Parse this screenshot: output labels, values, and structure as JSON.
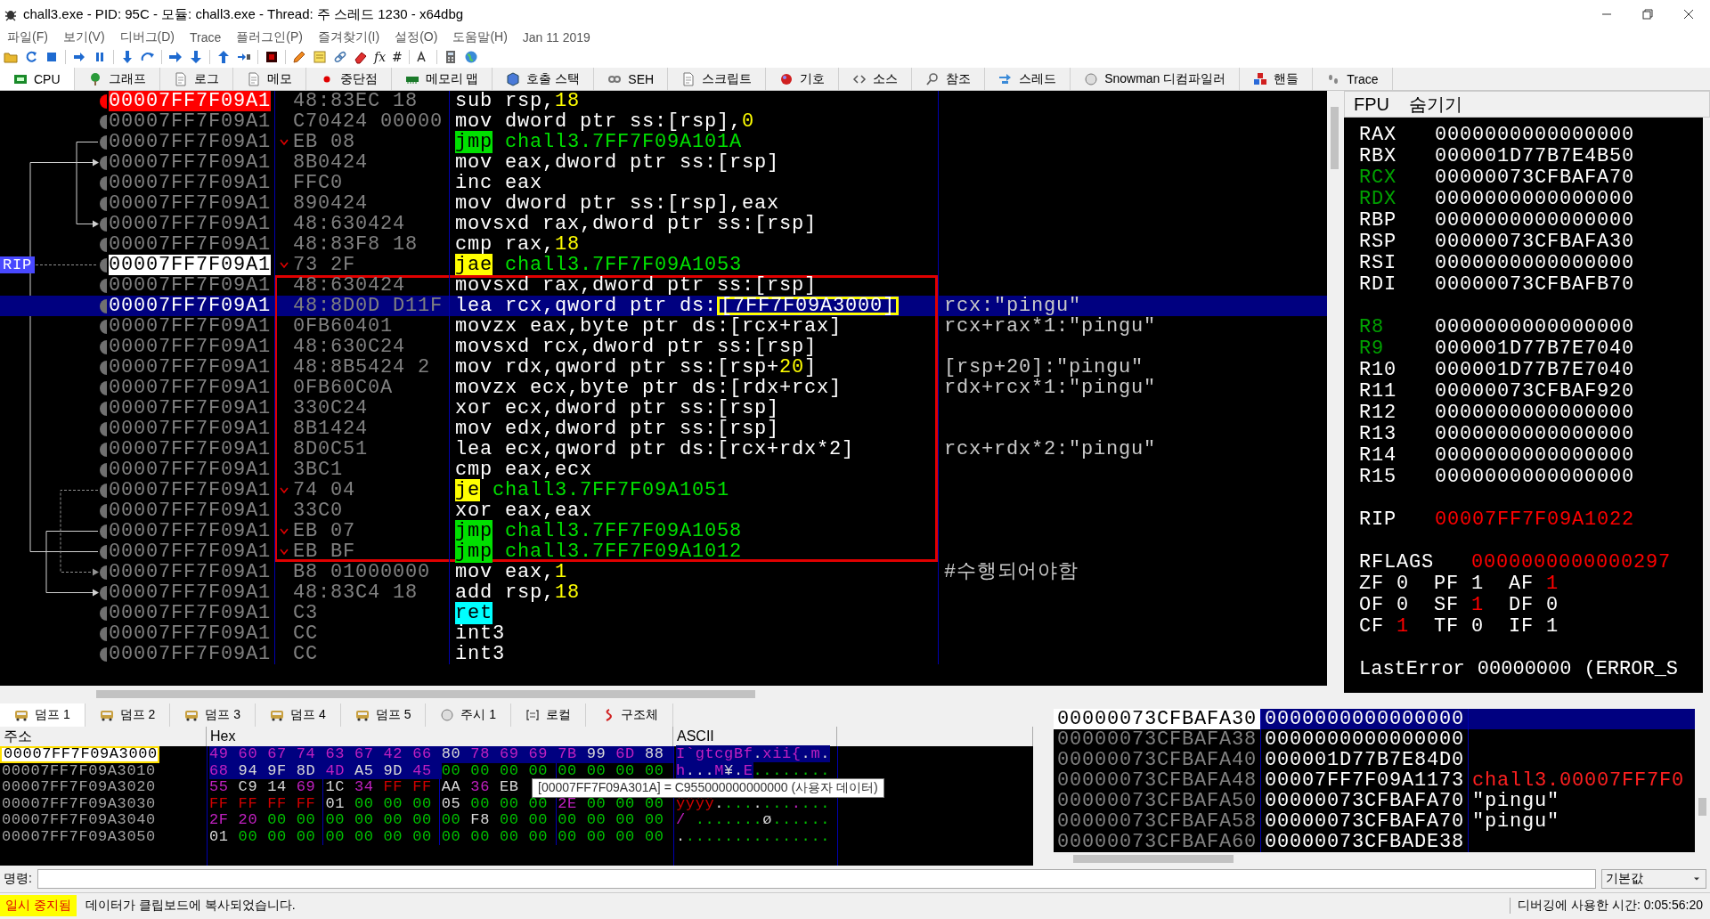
{
  "window": {
    "title": "chall3.exe - PID: 95C - 모듈: chall3.exe - Thread: 주 스레드 1230 - x64dbg"
  },
  "menu": [
    "파일(F)",
    "보기(V)",
    "디버그(D)",
    "Trace",
    "플러그인(P)",
    "즐겨찾기(I)",
    "설정(O)",
    "도움말(H)",
    "Jan 11 2019"
  ],
  "toolbar_texts": [
    "fx",
    "#"
  ],
  "tabs": [
    {
      "label": "CPU",
      "selected": true
    },
    {
      "label": "그래프",
      "selected": false
    },
    {
      "label": "로그",
      "selected": false
    },
    {
      "label": "메모",
      "selected": false
    },
    {
      "label": "중단점",
      "selected": false
    },
    {
      "label": "메모리 맵",
      "selected": false
    },
    {
      "label": "호출 스택",
      "selected": false
    },
    {
      "label": "SEH",
      "selected": false
    },
    {
      "label": "스크립트",
      "selected": false
    },
    {
      "label": "기호",
      "selected": false
    },
    {
      "label": "소스",
      "selected": false
    },
    {
      "label": "참조",
      "selected": false
    },
    {
      "label": "스레드",
      "selected": false
    },
    {
      "label": "Snowman 디컴파일러",
      "selected": false
    },
    {
      "label": "핸들",
      "selected": false
    },
    {
      "label": "Trace",
      "selected": false
    }
  ],
  "disasm": {
    "rip_label": "RIP",
    "rows": [
      {
        "address": "00007FF7F09A1",
        "bytes": "48:83EC 18",
        "mnemonic": "sub",
        "kind": "plain",
        "ops": [
          {
            "text": "rsp,",
            "kind": "text"
          },
          {
            "text": "18",
            "kind": "num"
          }
        ],
        "selected": false,
        "breakpoint": true,
        "current": false,
        "boxed": false
      },
      {
        "address": "00007FF7F09A1",
        "bytes": "C70424 00000",
        "mnemonic": "mov",
        "kind": "plain",
        "ops": [
          {
            "text": "dword ptr ss:[rsp],",
            "kind": "text"
          },
          {
            "text": "0",
            "kind": "num"
          }
        ],
        "selected": false,
        "breakpoint": false,
        "current": false,
        "boxed": false
      },
      {
        "address": "00007FF7F09A1",
        "bytes": "EB 08",
        "mnemonic": "jmp",
        "kind": "jump",
        "ops": [
          {
            "text": "chall3.7FF7F09A101A",
            "kind": "label"
          }
        ],
        "selected": false,
        "breakpoint": false,
        "current": false,
        "boxed": false
      },
      {
        "address": "00007FF7F09A1",
        "bytes": "8B0424",
        "mnemonic": "mov",
        "kind": "plain",
        "ops": [
          {
            "text": "eax,dword ptr ss:[rsp]",
            "kind": "text"
          }
        ],
        "selected": false,
        "breakpoint": false,
        "current": false,
        "boxed": false
      },
      {
        "address": "00007FF7F09A1",
        "bytes": "FFC0",
        "mnemonic": "inc",
        "kind": "plain",
        "ops": [
          {
            "text": "eax",
            "kind": "text"
          }
        ],
        "selected": false,
        "breakpoint": false,
        "current": false,
        "boxed": false
      },
      {
        "address": "00007FF7F09A1",
        "bytes": "890424",
        "mnemonic": "mov",
        "kind": "plain",
        "ops": [
          {
            "text": "dword ptr ss:[rsp],eax",
            "kind": "text"
          }
        ],
        "selected": false,
        "breakpoint": false,
        "current": false,
        "boxed": false
      },
      {
        "address": "00007FF7F09A1",
        "bytes": "48:630424",
        "mnemonic": "movsxd",
        "kind": "plain",
        "ops": [
          {
            "text": "rax,dword ptr ss:[rsp]",
            "kind": "text"
          }
        ],
        "selected": false,
        "breakpoint": false,
        "current": false,
        "boxed": false
      },
      {
        "address": "00007FF7F09A1",
        "bytes": "48:83F8 18",
        "mnemonic": "cmp",
        "kind": "plain",
        "ops": [
          {
            "text": "rax,",
            "kind": "text"
          },
          {
            "text": "18",
            "kind": "num"
          }
        ],
        "selected": false,
        "breakpoint": false,
        "current": false,
        "boxed": false
      },
      {
        "address": "00007FF7F09A1",
        "bytes": "73 2F",
        "mnemonic": "jae",
        "kind": "cond",
        "ops": [
          {
            "text": "chall3.7FF7F09A1053",
            "kind": "label"
          }
        ],
        "selected": false,
        "breakpoint": false,
        "current": true,
        "boxed": false
      },
      {
        "address": "00007FF7F09A1",
        "bytes": "48:630424",
        "mnemonic": "movsxd",
        "kind": "plain",
        "ops": [
          {
            "text": "rax,dword ptr ss:[rsp]",
            "kind": "text"
          }
        ],
        "selected": false,
        "breakpoint": false,
        "current": false,
        "boxed": true
      },
      {
        "address": "00007FF7F09A1",
        "bytes": "48:8D0D D11F",
        "mnemonic": "lea",
        "kind": "plain",
        "ops": [
          {
            "text": "rcx,qword ptr ds:",
            "kind": "text"
          },
          {
            "text": "[7FF7F09A3000]",
            "kind": "boxed"
          }
        ],
        "comment": "rcx:\"pingu\"",
        "selected": true,
        "breakpoint": false,
        "current": false,
        "boxed": true
      },
      {
        "address": "00007FF7F09A1",
        "bytes": "0FB60401",
        "mnemonic": "movzx",
        "kind": "plain",
        "ops": [
          {
            "text": "eax,byte ptr ds:[rcx+rax]",
            "kind": "text"
          }
        ],
        "comment": "rcx+rax*1:\"pingu\"",
        "selected": false,
        "breakpoint": false,
        "current": false,
        "boxed": true
      },
      {
        "address": "00007FF7F09A1",
        "bytes": "48:630C24",
        "mnemonic": "movsxd",
        "kind": "plain",
        "ops": [
          {
            "text": "rcx,dword ptr ss:[rsp]",
            "kind": "text"
          }
        ],
        "selected": false,
        "breakpoint": false,
        "current": false,
        "boxed": true
      },
      {
        "address": "00007FF7F09A1",
        "bytes": "48:8B5424 2",
        "mnemonic": "mov",
        "kind": "plain",
        "ops": [
          {
            "text": "rdx,qword ptr ss:[rsp+",
            "kind": "text"
          },
          {
            "text": "20",
            "kind": "num"
          },
          {
            "text": "]",
            "kind": "text"
          }
        ],
        "comment": "[rsp+20]:\"pingu\"",
        "selected": false,
        "breakpoint": false,
        "current": false,
        "boxed": true
      },
      {
        "address": "00007FF7F09A1",
        "bytes": "0FB60C0A",
        "mnemonic": "movzx",
        "kind": "plain",
        "ops": [
          {
            "text": "ecx,byte ptr ds:[rdx+rcx]",
            "kind": "text"
          }
        ],
        "comment": "rdx+rcx*1:\"pingu\"",
        "selected": false,
        "breakpoint": false,
        "current": false,
        "boxed": true
      },
      {
        "address": "00007FF7F09A1",
        "bytes": "330C24",
        "mnemonic": "xor",
        "kind": "plain",
        "ops": [
          {
            "text": "ecx,dword ptr ss:[rsp]",
            "kind": "text"
          }
        ],
        "selected": false,
        "breakpoint": false,
        "current": false,
        "boxed": true
      },
      {
        "address": "00007FF7F09A1",
        "bytes": "8B1424",
        "mnemonic": "mov",
        "kind": "plain",
        "ops": [
          {
            "text": "edx,dword ptr ss:[rsp]",
            "kind": "text"
          }
        ],
        "selected": false,
        "breakpoint": false,
        "current": false,
        "boxed": true
      },
      {
        "address": "00007FF7F09A1",
        "bytes": "8D0C51",
        "mnemonic": "lea",
        "kind": "plain",
        "ops": [
          {
            "text": "ecx,qword ptr ds:[rcx+rdx*2]",
            "kind": "text"
          }
        ],
        "comment": "rcx+rdx*2:\"pingu\"",
        "selected": false,
        "breakpoint": false,
        "current": false,
        "boxed": true
      },
      {
        "address": "00007FF7F09A1",
        "bytes": "3BC1",
        "mnemonic": "cmp",
        "kind": "plain",
        "ops": [
          {
            "text": "eax,ecx",
            "kind": "text"
          }
        ],
        "selected": false,
        "breakpoint": false,
        "current": false,
        "boxed": true
      },
      {
        "address": "00007FF7F09A1",
        "bytes": "74 04",
        "mnemonic": "je",
        "kind": "cond",
        "ops": [
          {
            "text": "chall3.7FF7F09A1051",
            "kind": "label"
          }
        ],
        "selected": false,
        "breakpoint": false,
        "current": false,
        "boxed": true
      },
      {
        "address": "00007FF7F09A1",
        "bytes": "33C0",
        "mnemonic": "xor",
        "kind": "plain",
        "ops": [
          {
            "text": "eax,eax",
            "kind": "text"
          }
        ],
        "selected": false,
        "breakpoint": false,
        "current": false,
        "boxed": true
      },
      {
        "address": "00007FF7F09A1",
        "bytes": "EB 07",
        "mnemonic": "jmp",
        "kind": "jump",
        "ops": [
          {
            "text": "chall3.7FF7F09A1058",
            "kind": "label"
          }
        ],
        "selected": false,
        "breakpoint": false,
        "current": false,
        "boxed": true
      },
      {
        "address": "00007FF7F09A1",
        "bytes": "EB BF",
        "mnemonic": "jmp",
        "kind": "jump",
        "ops": [
          {
            "text": "chall3.7FF7F09A1012",
            "kind": "label"
          }
        ],
        "selected": false,
        "breakpoint": false,
        "current": false,
        "boxed": true
      },
      {
        "address": "00007FF7F09A1",
        "bytes": "B8 01000000",
        "mnemonic": "mov",
        "kind": "plain",
        "ops": [
          {
            "text": "eax,",
            "kind": "text"
          },
          {
            "text": "1",
            "kind": "num"
          }
        ],
        "comment": "#수행되어야함",
        "selected": false,
        "breakpoint": false,
        "current": false,
        "boxed": false
      },
      {
        "address": "00007FF7F09A1",
        "bytes": "48:83C4 18",
        "mnemonic": "add",
        "kind": "plain",
        "ops": [
          {
            "text": "rsp,",
            "kind": "text"
          },
          {
            "text": "18",
            "kind": "num"
          }
        ],
        "selected": false,
        "breakpoint": false,
        "current": false,
        "boxed": false
      },
      {
        "address": "00007FF7F09A1",
        "bytes": "C3",
        "mnemonic": "ret",
        "kind": "ret",
        "ops": [],
        "selected": false,
        "breakpoint": false,
        "current": false,
        "boxed": false
      },
      {
        "address": "00007FF7F09A1",
        "bytes": "CC",
        "mnemonic": "int3",
        "kind": "plain",
        "ops": [],
        "selected": false,
        "breakpoint": false,
        "current": false,
        "boxed": false
      },
      {
        "address": "00007FF7F09A1",
        "bytes": "CC",
        "mnemonic": "int3",
        "kind": "plain",
        "ops": [],
        "selected": false,
        "breakpoint": false,
        "current": false,
        "boxed": false
      }
    ]
  },
  "registers": {
    "header": [
      "FPU",
      "숨기기"
    ],
    "groups": [
      {
        "rows": [
          {
            "name": "RAX",
            "value": "0000000000000000",
            "name_changed": false,
            "value_changed": false
          },
          {
            "name": "RBX",
            "value": "000001D77B7E4B50",
            "name_changed": false,
            "value_changed": false
          },
          {
            "name": "RCX",
            "value": "00000073CFBAFA70",
            "name_changed": true,
            "value_changed": false
          },
          {
            "name": "RDX",
            "value": "0000000000000000",
            "name_changed": true,
            "value_changed": false
          },
          {
            "name": "RBP",
            "value": "0000000000000000",
            "name_changed": false,
            "value_changed": false
          },
          {
            "name": "RSP",
            "value": "00000073CFBAFA30",
            "name_changed": false,
            "value_changed": false
          },
          {
            "name": "RSI",
            "value": "0000000000000000",
            "name_changed": false,
            "value_changed": false
          },
          {
            "name": "RDI",
            "value": "00000073CFBAFB70",
            "name_changed": false,
            "value_changed": false
          }
        ]
      },
      {
        "rows": [
          {
            "name": "R8",
            "value": "0000000000000000",
            "name_changed": true,
            "value_changed": false
          },
          {
            "name": "R9",
            "value": "000001D77B7E7040",
            "name_changed": true,
            "value_changed": false
          },
          {
            "name": "R10",
            "value": "000001D77B7E7040",
            "name_changed": false,
            "value_changed": false
          },
          {
            "name": "R11",
            "value": "00000073CFBAF920",
            "name_changed": false,
            "value_changed": false
          },
          {
            "name": "R12",
            "value": "0000000000000000",
            "name_changed": false,
            "value_changed": false
          },
          {
            "name": "R13",
            "value": "0000000000000000",
            "name_changed": false,
            "value_changed": false
          },
          {
            "name": "R14",
            "value": "0000000000000000",
            "name_changed": false,
            "value_changed": false
          },
          {
            "name": "R15",
            "value": "0000000000000000",
            "name_changed": false,
            "value_changed": false
          }
        ]
      },
      {
        "rows": [
          {
            "name": "RIP",
            "value": "00007FF7F09A1022",
            "name_changed": false,
            "value_changed": true
          }
        ]
      }
    ],
    "rflags": {
      "name": "RFLAGS",
      "value": "0000000000000297",
      "value_changed": true
    },
    "flags": [
      {
        "name": "ZF",
        "value": "0",
        "changed": false
      },
      {
        "name": "PF",
        "value": "1",
        "changed": false
      },
      {
        "name": "AF",
        "value": "1",
        "changed": true
      },
      {
        "name": "OF",
        "value": "0",
        "changed": false
      },
      {
        "name": "SF",
        "value": "1",
        "changed": true
      },
      {
        "name": "DF",
        "value": "0",
        "changed": false
      },
      {
        "name": "CF",
        "value": "1",
        "changed": true
      },
      {
        "name": "TF",
        "value": "0",
        "changed": false
      },
      {
        "name": "IF",
        "value": "1",
        "changed": false
      }
    ],
    "last_error": {
      "name": "LastError",
      "value": "00000000",
      "detail": "(ERROR_S"
    }
  },
  "dump_tabs": [
    {
      "label": "덤프 1",
      "selected": true
    },
    {
      "label": "덤프 2",
      "selected": false
    },
    {
      "label": "덤프 3",
      "selected": false
    },
    {
      "label": "덤프 4",
      "selected": false
    },
    {
      "label": "덤프 5",
      "selected": false
    },
    {
      "label": "주시 1",
      "selected": false
    },
    {
      "label": "로컬",
      "selected": false
    },
    {
      "label": "구조체",
      "selected": false
    }
  ],
  "dump": {
    "columns": [
      "주소",
      "Hex",
      "ASCII"
    ],
    "rows": [
      {
        "address": "00007FF7F09A3000",
        "boxed": true,
        "selected_hex": "49 60 67 74 63 67 42 66 80 78 69 69 7B 99 6D 88",
        "selected_ascii": "I`gtcgBf.xii{.m."
      },
      {
        "address": "00007FF7F09A3010",
        "boxed": false,
        "selected_hex": "68 94 9F 8D 4D A5 9D 45",
        "hex": "00 00 00 00 00 00 00 00",
        "selected_ascii": "h...M¥.E",
        "ascii": "........"
      },
      {
        "address": "00007FF7F09A3020",
        "boxed": false,
        "hex": "55 C9 14 69 1C 34 FF FF AA 36 EB"
      },
      {
        "address": "00007FF7F09A3030",
        "boxed": false,
        "hex": "FF FF FF FF 01 00 00 00 05 00 00 00 2E 00 00 00",
        "ascii": "ÿÿÿÿ............"
      },
      {
        "address": "00007FF7F09A3040",
        "boxed": false,
        "hex": "2F 20 00 00 00 00 00 00 00 F8 00 00 00 00 00 00",
        "ascii": "/ .......ø......"
      },
      {
        "address": "00007FF7F09A3050",
        "boxed": false,
        "hex": "01 00 00 00 00 00 00 00 00 00 00 00 00 00 00 00",
        "ascii": "................"
      }
    ],
    "tooltip": "[00007FF7F09A301A] = C955000000000000 (사용자 데이터)"
  },
  "stack": {
    "rows": [
      {
        "address": "00000073CFBAFA30",
        "value": "0000000000000000",
        "selected": true
      },
      {
        "address": "00000073CFBAFA38",
        "value": "0000000000000000",
        "selected": false
      },
      {
        "address": "00000073CFBAFA40",
        "value": "000001D77B7E84D0",
        "selected": false
      },
      {
        "address": "00000073CFBAFA48",
        "value": "00007FF7F09A1173",
        "comment": {
          "text": "chall3.00007FF7F0",
          "kind": "module"
        },
        "selected": false
      },
      {
        "address": "00000073CFBAFA50",
        "value": "00000073CFBAFA70",
        "comment": {
          "text": "\"pingu\"",
          "kind": "string"
        },
        "selected": false
      },
      {
        "address": "00000073CFBAFA58",
        "value": "00000073CFBAFA70",
        "comment": {
          "text": "\"pingu\"",
          "kind": "string"
        },
        "selected": false
      },
      {
        "address": "00000073CFBAFA60",
        "value": "00000073CFBADE38",
        "selected": false
      }
    ]
  },
  "command": {
    "label": "명령:",
    "mode": "기본값"
  },
  "status_bar": {
    "state": "일시 중지됨",
    "message": "데이터가 클립보드에 복사되었습니다.",
    "elapsed": "디버깅에 사용한 시간: 0:05:56:20"
  }
}
